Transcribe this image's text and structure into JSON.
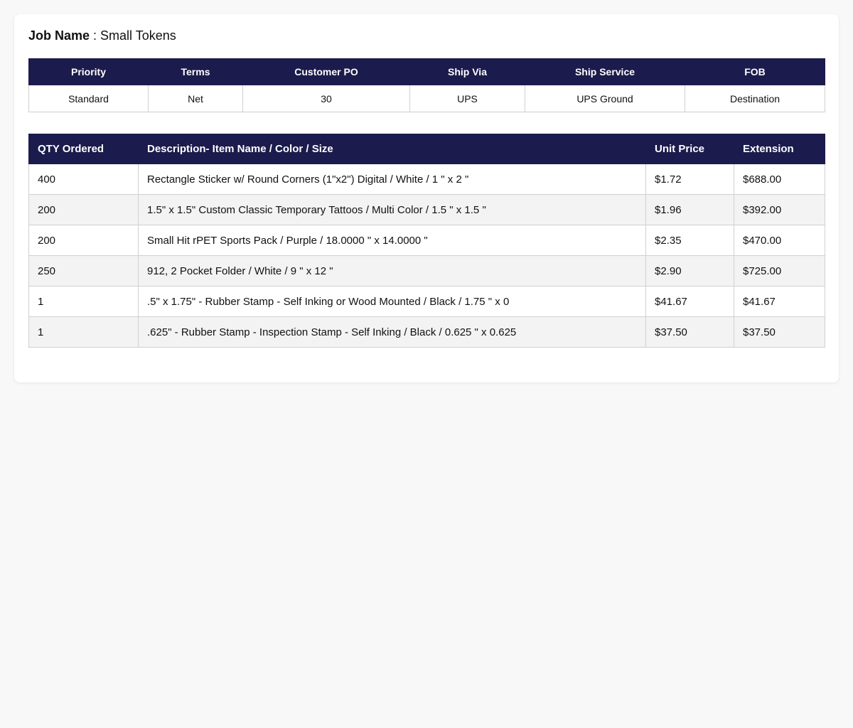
{
  "job": {
    "label": "Job Name",
    "separator": " : ",
    "value": "Small Tokens"
  },
  "order_info": {
    "headers": [
      "Priority",
      "Terms",
      "Customer PO",
      "Ship Via",
      "Ship Service",
      "FOB"
    ],
    "values": [
      "Standard",
      "Net",
      "30",
      "UPS",
      "UPS Ground",
      "Destination"
    ]
  },
  "items": {
    "headers": [
      "QTY Ordered",
      "Description- Item Name / Color / Size",
      "Unit Price",
      "Extension"
    ],
    "rows": [
      {
        "qty": "400",
        "description": "Rectangle Sticker w/ Round Corners (1\"x2\") Digital / White / 1 \" x 2 \"",
        "unit_price": "$1.72",
        "extension": "$688.00"
      },
      {
        "qty": "200",
        "description": "1.5\" x 1.5\" Custom Classic Temporary Tattoos / Multi Color / 1.5 \" x 1.5 \"",
        "unit_price": "$1.96",
        "extension": "$392.00"
      },
      {
        "qty": "200",
        "description": "Small Hit rPET Sports Pack / Purple / 18.0000 \" x 14.0000 \"",
        "unit_price": "$2.35",
        "extension": "$470.00"
      },
      {
        "qty": "250",
        "description": "912, 2 Pocket Folder / White / 9 \" x 12 \"",
        "unit_price": "$2.90",
        "extension": "$725.00"
      },
      {
        "qty": "1",
        "description": ".5\" x 1.75\" - Rubber Stamp - Self Inking or Wood Mounted / Black / 1.75 \" x 0",
        "unit_price": "$41.67",
        "extension": "$41.67"
      },
      {
        "qty": "1",
        "description": ".625\" - Rubber Stamp - Inspection Stamp - Self Inking / Black / 0.625 \" x 0.625",
        "unit_price": "$37.50",
        "extension": "$37.50"
      }
    ]
  },
  "colors": {
    "header_bg": "#1c1b4d",
    "page_bg": "#f8f8f8",
    "alt_row_bg": "#f3f3f3"
  }
}
